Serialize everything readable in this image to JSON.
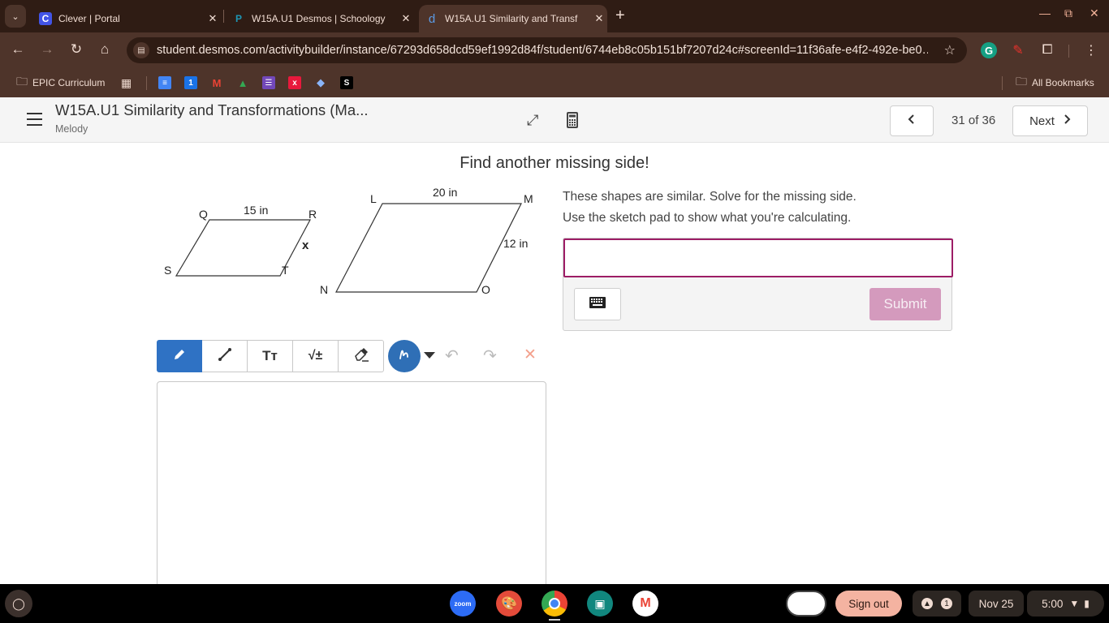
{
  "browser": {
    "tabs": [
      {
        "title": "Clever | Portal",
        "favicon": "C",
        "favicon_color": "#4254e6",
        "active": false
      },
      {
        "title": "W15A.U1 Desmos | Schoology",
        "favicon": "P",
        "favicon_color": "#1e96b5",
        "active": false
      },
      {
        "title": "W15A.U1 Similarity and Transf",
        "favicon": "d",
        "favicon_color": "#5c9be6",
        "active": true
      }
    ],
    "url": "student.desmos.com/activitybuilder/instance/67293d658dcd59ef1992d84f/student/6744eb8c05b151bf7207d24c#screenId=11f36afe-e4f2-492e-be0…",
    "bookmarks": {
      "folder": "EPIC Curriculum",
      "all_bookmarks": "All Bookmarks",
      "icons": [
        {
          "name": "docs",
          "glyph": "≡",
          "color": "#4285f4"
        },
        {
          "name": "calendar",
          "glyph": "1",
          "color": "#1a73e8"
        },
        {
          "name": "gmail",
          "glyph": "M",
          "color": "#ea4335"
        },
        {
          "name": "drive",
          "glyph": "▲",
          "color": "#34a853"
        },
        {
          "name": "forms",
          "glyph": "☰",
          "color": "#7248b9"
        },
        {
          "name": "x-app",
          "glyph": "x",
          "color": "#e8193c"
        },
        {
          "name": "gem",
          "glyph": "◆",
          "color": "#8ab4f8"
        },
        {
          "name": "s-app",
          "glyph": "S",
          "color": "#000000"
        }
      ]
    }
  },
  "header": {
    "activity_title": "W15A.U1 Similarity and Transformations (Ma...",
    "student_name": "Melody",
    "screen_position": "31 of 36",
    "next_label": "Next"
  },
  "screen": {
    "title": "Find another missing side!",
    "instructions": [
      "These shapes are similar.  Solve for the missing side.",
      "Use the sketch pad to show what you're calculating."
    ],
    "answer_value": "",
    "submit_label": "Submit"
  },
  "figure": {
    "small_shape": {
      "vertices": [
        "Q",
        "R",
        "T",
        "S"
      ],
      "top_label": "15 in",
      "side_label": "x"
    },
    "large_shape": {
      "vertices": [
        "L",
        "M",
        "O",
        "N"
      ],
      "top_label": "20 in",
      "side_label": "12 in"
    }
  },
  "sketch": {
    "tools": [
      {
        "name": "pen",
        "glyph": "✎",
        "active": true
      },
      {
        "name": "line",
        "glyph": "⟋",
        "active": false
      },
      {
        "name": "text",
        "glyph": "Tт",
        "active": false
      },
      {
        "name": "math",
        "glyph": "√±",
        "active": false
      },
      {
        "name": "eraser",
        "glyph": "⌫",
        "active": false
      }
    ],
    "color": "#2f6fb6"
  },
  "shelf": {
    "apps": [
      "zoom",
      "canvas",
      "chrome",
      "classroom",
      "gmail"
    ],
    "signout_label": "Sign out",
    "notification_count": "1",
    "date": "Nov 25",
    "time": "5:00"
  }
}
